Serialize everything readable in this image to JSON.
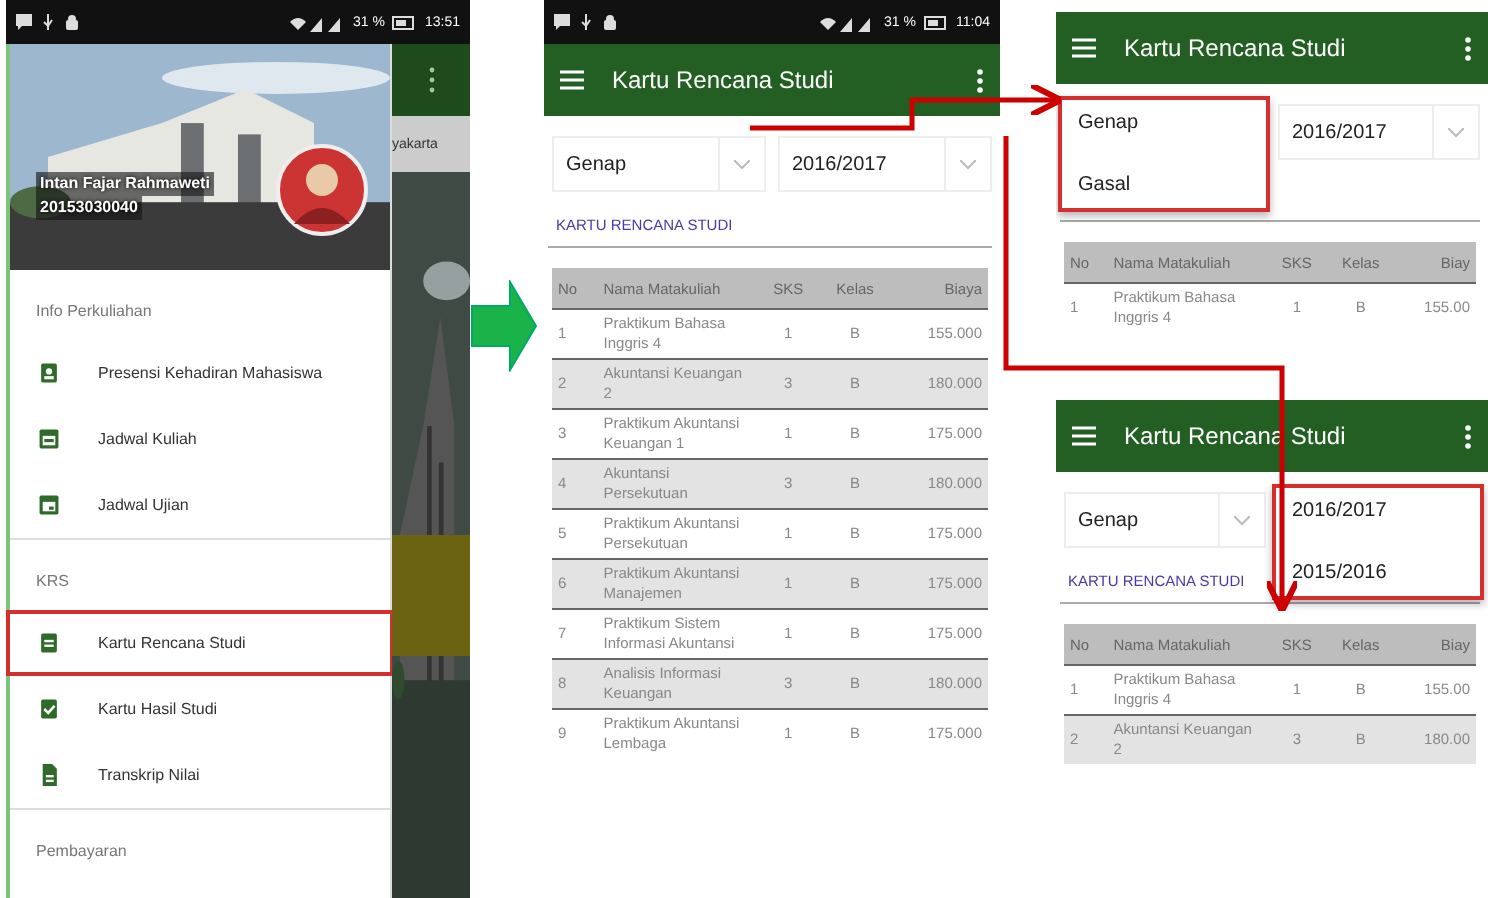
{
  "drawer_screen": {
    "status_bar": {
      "battery": "31 %",
      "time": "13:51"
    },
    "profile": {
      "name": "Intan Fajar Rahmaweti",
      "student_id": "20153030040"
    },
    "background_app": {
      "text": "yakarta"
    },
    "sections": [
      {
        "title": "Info Perkuliahan",
        "items": [
          {
            "label": "Presensi Kehadiran Mahasiswa",
            "highlighted": false
          },
          {
            "label": "Jadwal Kuliah",
            "highlighted": false
          },
          {
            "label": "Jadwal Ujian",
            "highlighted": false
          }
        ]
      },
      {
        "title": "KRS",
        "items": [
          {
            "label": "Kartu Rencana Studi",
            "highlighted": true
          },
          {
            "label": "Kartu Hasil Studi",
            "highlighted": false
          },
          {
            "label": "Transkrip Nilai",
            "highlighted": false
          }
        ]
      },
      {
        "title": "Pembayaran"
      }
    ]
  },
  "krs_screens": [
    {
      "status_bar": {
        "battery": "31 %",
        "time": "11:04"
      },
      "title": "Kartu Rencana Studi",
      "spinners": [
        {
          "value": "Genap",
          "open": false
        },
        {
          "value": "2016/2017",
          "open": false
        }
      ],
      "link": "KARTU RENCANA STUDI",
      "columns": [
        "No",
        "Nama Matakuliah",
        "SKS",
        "Kelas",
        "Biaya"
      ],
      "rows": [
        [
          "1",
          "Praktikum Bahasa Inggris 4",
          "1",
          "B",
          "155.000"
        ],
        [
          "2",
          "Akuntansi Keuangan 2",
          "3",
          "B",
          "180.000"
        ],
        [
          "3",
          "Praktikum Akuntansi Keuangan 1",
          "1",
          "B",
          "175.000"
        ],
        [
          "4",
          "Akuntansi Persekutuan",
          "3",
          "B",
          "180.000"
        ],
        [
          "5",
          "Praktikum Akuntansi Persekutuan",
          "1",
          "B",
          "175.000"
        ],
        [
          "6",
          "Praktikum Akuntansi Manajemen",
          "1",
          "B",
          "175.000"
        ],
        [
          "7",
          "Praktikum Sistem Informasi Akuntansi",
          "1",
          "B",
          "175.000"
        ],
        [
          "8",
          "Analisis Informasi Keuangan",
          "3",
          "B",
          "180.000"
        ],
        [
          "9",
          "Praktikum Akuntansi Lembaga",
          "1",
          "B",
          "175.000"
        ]
      ]
    },
    {
      "title": "Kartu Rencana Studi",
      "spinners": [
        {
          "open": true,
          "options": [
            "Genap",
            "Gasal"
          ]
        },
        {
          "value": "2016/2017",
          "open": false
        }
      ],
      "columns": [
        "No",
        "Nama Matakuliah",
        "SKS",
        "Kelas",
        "Biay"
      ],
      "rows": [
        [
          "1",
          "Praktikum Bahasa Inggris 4",
          "1",
          "B",
          "155.00"
        ]
      ]
    },
    {
      "title": "Kartu Rencana Studi",
      "spinners": [
        {
          "value": "Genap",
          "open": false
        },
        {
          "open": true,
          "options": [
            "2016/2017",
            "2015/2016"
          ]
        }
      ],
      "link": "KARTU RENCANA STUDI",
      "columns": [
        "No",
        "Nama Matakuliah",
        "SKS",
        "Kelas",
        "Biay"
      ],
      "rows": [
        [
          "1",
          "Praktikum Bahasa Inggris 4",
          "1",
          "B",
          "155.00"
        ],
        [
          "2",
          "Akuntansi Keuangan 2",
          "3",
          "B",
          "180.00"
        ]
      ]
    }
  ]
}
